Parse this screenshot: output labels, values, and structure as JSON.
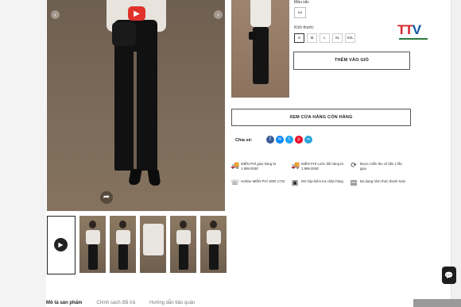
{
  "product_options": {
    "color_label": "Màu sắc",
    "color_value": "Đỏ",
    "size_label": "Kích thước",
    "sizes": [
      "S",
      "M",
      "L",
      "XL",
      "XXL"
    ],
    "selected_size": "S"
  },
  "buttons": {
    "add_to_cart": "THÊM VÀO GIỎ",
    "view_stores": "XEM CỬA HÀNG CÒN HÀNG"
  },
  "share": {
    "label": "Chia sẻ:",
    "networks": [
      {
        "icon": "facebook-icon",
        "glyph": "f",
        "color": "#3b5998"
      },
      {
        "icon": "messenger-icon",
        "glyph": "m",
        "color": "#0084ff"
      },
      {
        "icon": "twitter-icon",
        "glyph": "t",
        "color": "#1da1f2"
      },
      {
        "icon": "pinterest-icon",
        "glyph": "p",
        "color": "#e60023"
      },
      {
        "icon": "link-icon",
        "glyph": "∞",
        "color": "#2aa3db"
      }
    ]
  },
  "benefits": [
    {
      "icon": "truck-icon",
      "glyph": "🚚",
      "text": "MIỄN PHÍ giao hàng từ 1.999.000đ"
    },
    {
      "icon": "truck-return-icon",
      "glyph": "🚚",
      "text": "MIỄN PHÍ cước đổi hàng từ 1.999.000đ"
    },
    {
      "icon": "exchange-icon",
      "glyph": "⟳",
      "text": "Được miễn thu cổ tiền 1 lần giao"
    },
    {
      "icon": "headset-icon",
      "glyph": "☏",
      "text": "Hotline MIỄN PHÍ 1800 1732"
    },
    {
      "icon": "box-icon",
      "glyph": "▣",
      "text": "Mở hộp kiểm tra nhận hàng"
    },
    {
      "icon": "payment-icon",
      "glyph": "▤",
      "text": "Đa dạng hình thức thanh toán"
    }
  ],
  "tabs": [
    "Mô tả sản phẩm",
    "Chính sách đổi trả",
    "Hướng dẫn bảo quản"
  ],
  "active_tab": 0,
  "logo": {
    "text_red": "TT",
    "text_blue": "V"
  },
  "colors": {
    "accent_red": "#e0322b",
    "ttv_red": "#d8262d",
    "ttv_blue": "#0c57a4",
    "border_dark": "#555555"
  }
}
